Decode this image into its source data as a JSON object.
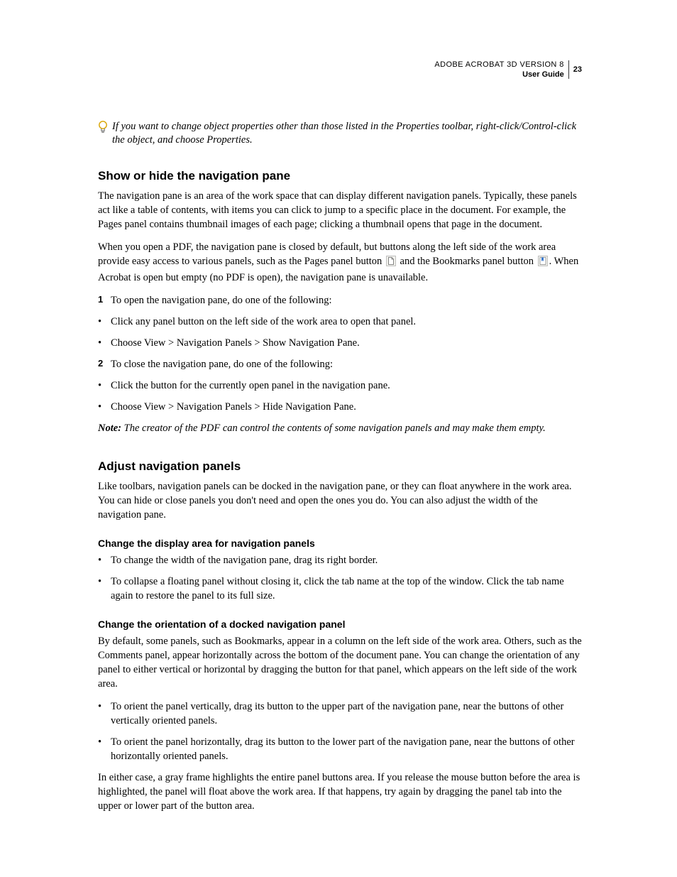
{
  "header": {
    "title": "ADOBE ACROBAT 3D VERSION 8",
    "subtitle": "User Guide",
    "page_number": "23"
  },
  "tip": "If you want to change object properties other than those listed in the Properties toolbar, right-click/Control-click the object, and choose Properties.",
  "s1": {
    "heading": "Show or hide the navigation pane",
    "p1": "The navigation pane is an area of the work space that can display different navigation panels. Typically, these panels act like a table of contents, with items you can click to jump to a specific place in the document. For example, the Pages panel contains thumbnail images of each page; clicking a thumbnail opens that page in the document.",
    "p2a": "When you open a PDF, the navigation pane is closed by default, but buttons along the left side of the work area provide easy access to various panels, such as the Pages panel button ",
    "p2b": " and the Bookmarks panel button ",
    "p2c": ". When Acrobat is open but empty (no PDF is open), the navigation pane is unavailable.",
    "n1": "To open the navigation pane, do one of the following:",
    "b1": "Click any panel button on the left side of the work area to open that panel.",
    "b2": "Choose View > Navigation Panels > Show Navigation Pane.",
    "n2": "To close the navigation pane, do one of the following:",
    "b3": "Click the button for the currently open panel in the navigation pane.",
    "b4": "Choose View > Navigation Panels > Hide Navigation Pane.",
    "note_label": "Note:",
    "note": " The creator of the PDF can control the contents of some navigation panels and may make them empty."
  },
  "s2": {
    "heading": "Adjust navigation panels",
    "p1": "Like toolbars, navigation panels can be docked in the navigation pane, or they can float anywhere in the work area. You can hide or close panels you don't need and open the ones you do. You can also adjust the width of the navigation pane.",
    "sub1": {
      "heading": "Change the display area for navigation panels",
      "b1": "To change the width of the navigation pane, drag its right border.",
      "b2": "To collapse a floating panel without closing it, click the tab name at the top of the window. Click the tab name again to restore the panel to its full size."
    },
    "sub2": {
      "heading": "Change the orientation of a docked navigation panel",
      "p1": "By default, some panels, such as Bookmarks, appear in a column on the left side of the work area. Others, such as the Comments panel, appear horizontally across the bottom of the document pane. You can change the orientation of any panel to either vertical or horizontal by dragging the button for that panel, which appears on the left side of the work area.",
      "b1": "To orient the panel vertically, drag its button to the upper part of the navigation pane, near the buttons of other vertically oriented panels.",
      "b2": "To orient the panel horizontally, drag its button to the lower part of the navigation pane, near the buttons of other horizontally oriented panels.",
      "p2": "In either case, a gray frame highlights the entire panel buttons area. If you release the mouse button before the area is highlighted, the panel will float above the work area. If that happens, try again by dragging the panel tab into the upper or lower part of the button area."
    }
  }
}
